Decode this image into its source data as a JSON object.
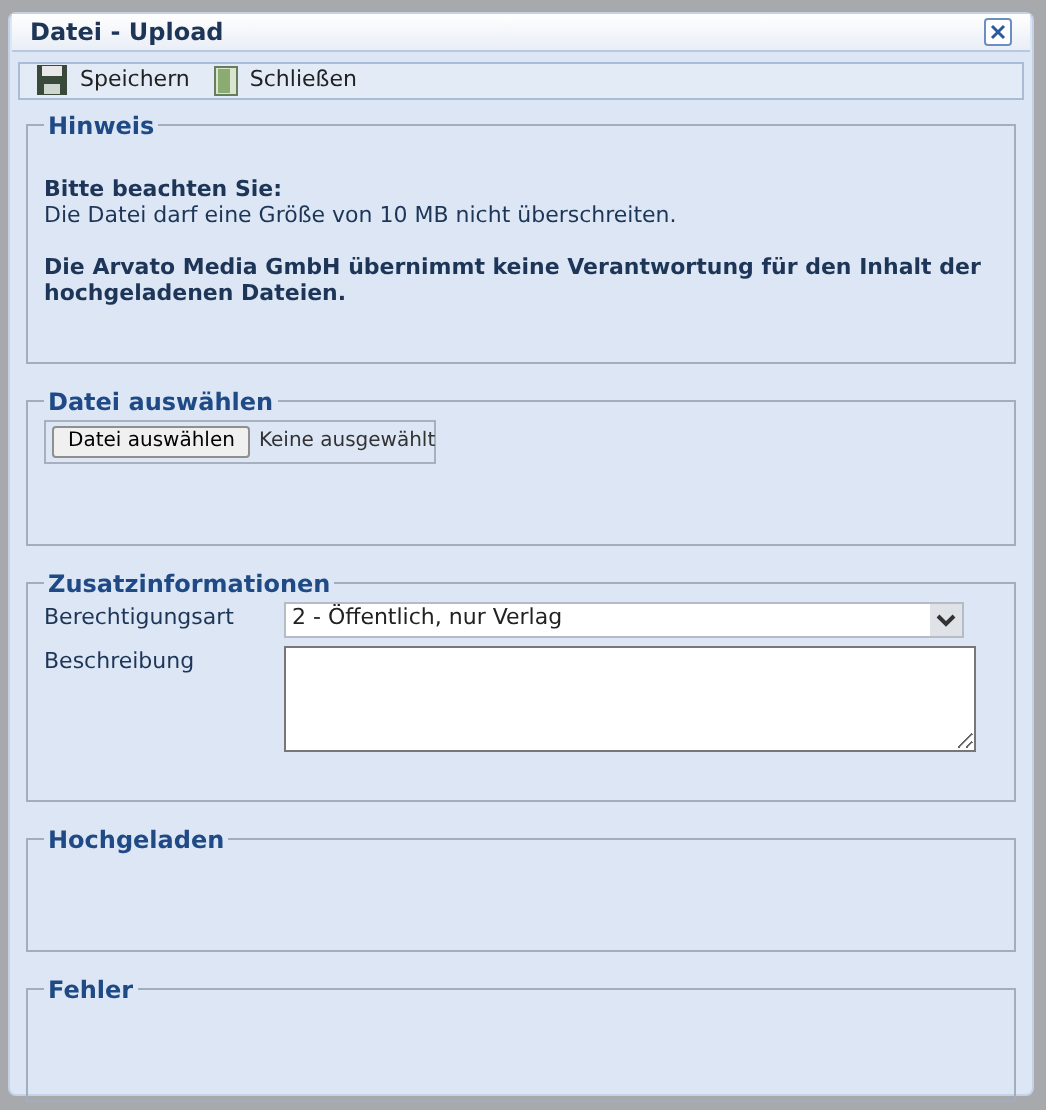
{
  "window": {
    "title": "Datei - Upload"
  },
  "toolbar": [
    {
      "kind": "save",
      "label": "Speichern"
    },
    {
      "kind": "close",
      "label": "Schließen"
    }
  ],
  "sections": [
    {
      "kind": "notice",
      "title": "Hinweis",
      "heading": "Bitte beachten Sie:",
      "text": "Die Datei darf eine Größe von 10 MB nicht überschreiten.",
      "disclaimer": "Die Arvato Media GmbH übernimmt keine Verantwortung für den Inhalt der hochgeladenen Dateien."
    },
    {
      "kind": "file",
      "title": "Datei auswählen",
      "button": "Datei auswählen",
      "status": "Keine ausgewählt"
    },
    {
      "kind": "info",
      "title": "Zusatzinformationen",
      "fields": [
        {
          "kind": "select",
          "label": "Berechtigungsart",
          "value": "2 - Öffentlich, nur Verlag"
        },
        {
          "kind": "textarea",
          "label": "Beschreibung"
        }
      ]
    },
    {
      "kind": "empty",
      "title": "Hochgeladen"
    },
    {
      "kind": "empty",
      "title": "Fehler"
    }
  ]
}
